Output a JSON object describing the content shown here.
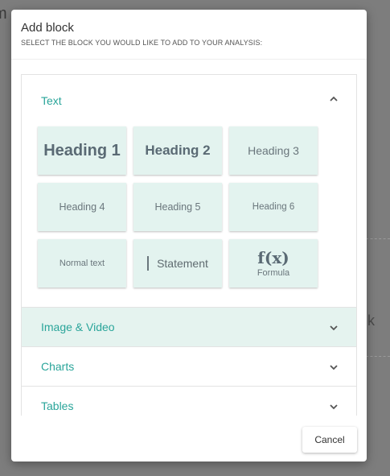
{
  "background": {
    "title_fragment": "m",
    "side_fragment": "k"
  },
  "modal": {
    "title": "Add block",
    "subtitle": "SELECT THE BLOCK YOU WOULD LIKE TO ADD TO YOUR ANALYSIS:"
  },
  "sections": [
    {
      "label": "Text",
      "expanded": true,
      "chevron": "up",
      "tiles": [
        {
          "label": "Heading 1"
        },
        {
          "label": "Heading 2"
        },
        {
          "label": "Heading 3"
        },
        {
          "label": "Heading 4"
        },
        {
          "label": "Heading 5"
        },
        {
          "label": "Heading 6"
        },
        {
          "label": "Normal text"
        },
        {
          "label": "Statement"
        },
        {
          "label": "Formula",
          "icon": "f(x)"
        }
      ]
    },
    {
      "label": "Image & Video",
      "expanded": false,
      "chevron": "down",
      "highlighted": true
    },
    {
      "label": "Charts",
      "expanded": false,
      "chevron": "down"
    },
    {
      "label": "Tables",
      "expanded": false,
      "chevron": "down"
    }
  ],
  "footer": {
    "cancel_label": "Cancel"
  },
  "colors": {
    "accent": "#2aa59a",
    "tile_bg": "#e3f3ef",
    "highlight_bg": "#e5f3ef",
    "overlay": "#7d7d7d"
  }
}
